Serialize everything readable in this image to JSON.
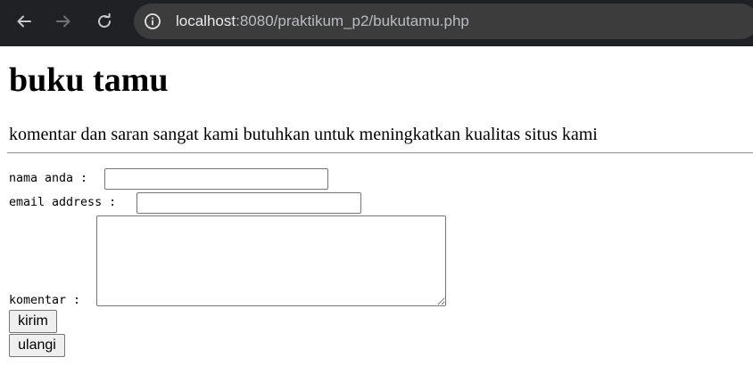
{
  "browser": {
    "url_host": "localhost",
    "url_rest": ":8080/praktikum_p2/bukutamu.php",
    "icons": {
      "back": "arrow-left-icon",
      "forward": "arrow-right-icon",
      "reload": "reload-icon",
      "site_info": "info-icon"
    }
  },
  "page": {
    "title": "buku tamu",
    "subtitle": "komentar dan saran sangat kami butuhkan untuk meningkatkan kualitas situs kami"
  },
  "form": {
    "nama_label": "nama anda : ",
    "nama_value": "",
    "email_label": "email address : ",
    "email_value": "",
    "komentar_label": "komentar : ",
    "komentar_value": "",
    "submit_label": "kirim",
    "reset_label": "ulangi"
  },
  "colors": {
    "chrome_bg": "#202124",
    "address_bg": "#3c3c3c",
    "button_bg": "#efefef"
  }
}
